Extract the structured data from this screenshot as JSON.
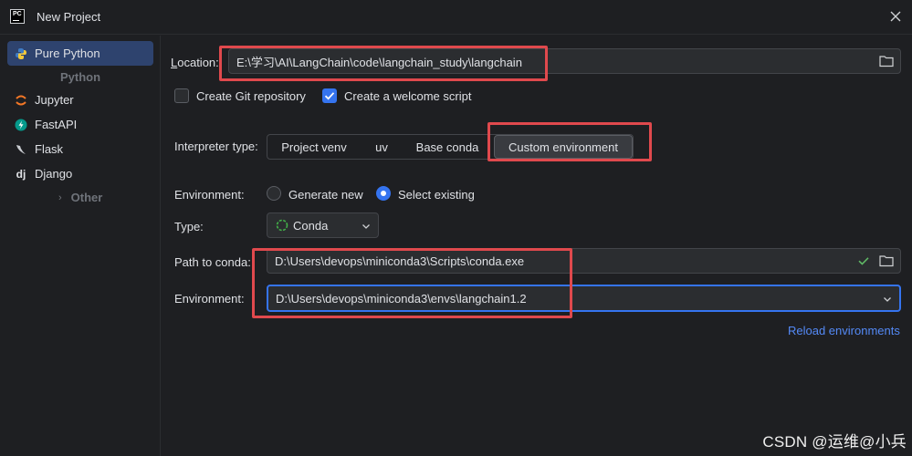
{
  "window": {
    "title": "New Project",
    "logo_text": "PC"
  },
  "sidebar": {
    "items": [
      {
        "label": "Pure Python",
        "icon": "python-icon",
        "selected": true
      },
      {
        "label": "Jupyter",
        "icon": "jupyter-icon"
      },
      {
        "label": "FastAPI",
        "icon": "fastapi-icon"
      },
      {
        "label": "Flask",
        "icon": "flask-icon"
      },
      {
        "label": "Django",
        "icon": "django-icon"
      }
    ],
    "group_python": "Python",
    "group_other": "Other",
    "django_glyph": "dj"
  },
  "location": {
    "label": "Location:",
    "value": "E:\\学习\\AI\\LangChain\\code\\langchain_study\\langchain"
  },
  "options": {
    "git_label": "Create Git repository",
    "git_checked": false,
    "welcome_label": "Create a welcome script",
    "welcome_checked": true
  },
  "interpreter": {
    "label": "Interpreter type:",
    "options": [
      "Project venv",
      "uv",
      "Base conda",
      "Custom environment"
    ],
    "selected": "Custom environment"
  },
  "environment_mode": {
    "label": "Environment:",
    "generate_label": "Generate new",
    "existing_label": "Select existing",
    "selected": "Select existing"
  },
  "type": {
    "label": "Type:",
    "value": "Conda"
  },
  "conda": {
    "label": "Path to conda:",
    "value": "D:\\Users\\devops\\miniconda3\\Scripts\\conda.exe"
  },
  "environment": {
    "label": "Environment:",
    "value": "D:\\Users\\devops\\miniconda3\\envs\\langchain1.2"
  },
  "reload_label": "Reload environments",
  "watermark": "CSDN @运维@小兵",
  "colors": {
    "accent": "#3574f0",
    "highlight_box": "#e0494d",
    "link": "#548af7",
    "success": "#5fb865"
  }
}
